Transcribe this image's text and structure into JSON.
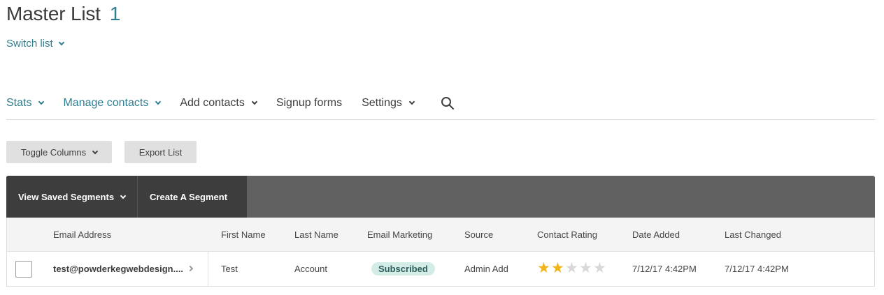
{
  "header": {
    "title": "Master List",
    "count": "1",
    "switch_list": "Switch list"
  },
  "nav": {
    "stats": "Stats",
    "manage_contacts": "Manage contacts",
    "add_contacts": "Add contacts",
    "signup_forms": "Signup forms",
    "settings": "Settings"
  },
  "toolbar": {
    "toggle_columns": "Toggle Columns",
    "export_list": "Export List"
  },
  "segments": {
    "view_saved": "View Saved Segments",
    "create": "Create A Segment"
  },
  "table": {
    "columns": [
      "Email Address",
      "First Name",
      "Last Name",
      "Email Marketing",
      "Source",
      "Contact Rating",
      "Date Added",
      "Last Changed"
    ],
    "rows": [
      {
        "email": "test@powderkegwebdesign....",
        "first_name": "Test",
        "last_name": "Account",
        "email_marketing": "Subscribed",
        "source": "Admin Add",
        "rating": 2,
        "rating_max": 5,
        "date_added": "7/12/17 4:42PM",
        "last_changed": "7/12/17 4:42PM"
      }
    ]
  },
  "colors": {
    "accent": "#2f7d8f",
    "segment_bar": "#616161",
    "segment_active": "#3d3d3d",
    "badge_bg": "#d3ece6",
    "star_on": "#f0b41e",
    "star_off": "#d8d8d8"
  },
  "icons": {
    "search": "search-icon",
    "chevron": "chevron-down-icon",
    "row_arrow": "chevron-right-icon",
    "star": "star-icon"
  }
}
